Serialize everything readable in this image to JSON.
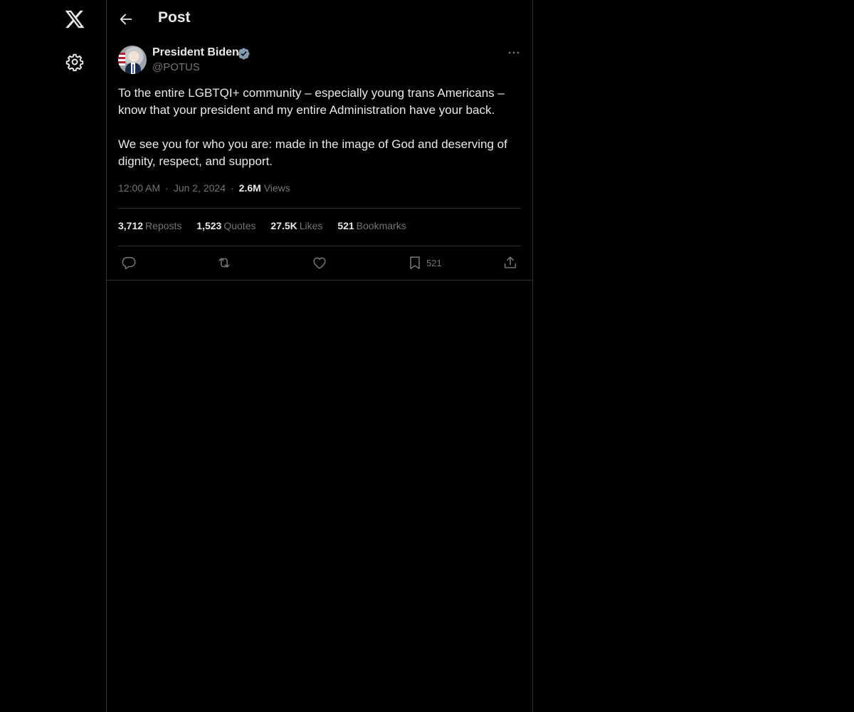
{
  "nav": {
    "logo_icon": "x-logo-icon",
    "settings_icon": "gear-icon"
  },
  "header": {
    "back_icon": "arrow-left-icon",
    "title": "Post"
  },
  "post": {
    "author": {
      "name": "President Biden",
      "handle": "@POTUS",
      "verified": true,
      "verified_color": "#829aab"
    },
    "text": "To the entire LGBTQI+ community – especially young trans Americans – know that your president and my entire Administration have your back.\n\nWe see you for who you are: made in the image of God and deserving of dignity, respect, and support.",
    "time": "12:00 AM",
    "date": "Jun 2, 2024",
    "views_count": "2.6M",
    "views_label": "Views",
    "stats": {
      "reposts_count": "3,712",
      "reposts_label": "Reposts",
      "quotes_count": "1,523",
      "quotes_label": "Quotes",
      "likes_count": "27.5K",
      "likes_label": "Likes",
      "bookmarks_count": "521",
      "bookmarks_label": "Bookmarks"
    },
    "actions": {
      "reply_icon": "reply-icon",
      "repost_icon": "repost-icon",
      "like_icon": "heart-icon",
      "bookmark_icon": "bookmark-icon",
      "bookmark_count": "521",
      "share_icon": "share-icon"
    }
  },
  "colors": {
    "background": "#000000",
    "text_primary": "#e7e9ea",
    "text_secondary": "#71767b",
    "border": "#2f3336"
  }
}
